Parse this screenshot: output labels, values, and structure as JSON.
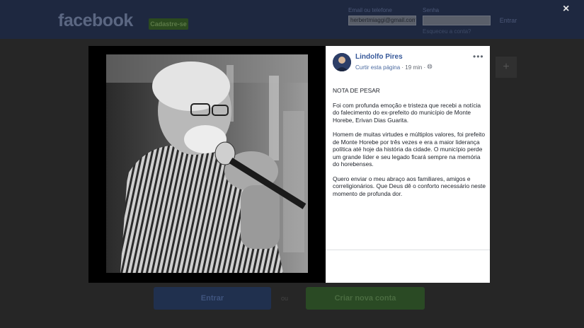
{
  "background": {
    "logo": "facebook",
    "signup_button": "Cadastre-se",
    "email_label": "Email ou telefone",
    "email_value": "herbertmiaggi@gmail.com",
    "password_label": "Senha",
    "login_button": "Entrar",
    "forgot_link": "Esqueceu a conta?",
    "bottom_login": "Entrar",
    "bottom_or": "ou",
    "bottom_create": "Criar nova conta"
  },
  "close_icon": "×",
  "post": {
    "author": "Lindolfo Pires",
    "like_page": "Curtir esta página",
    "separator": "·",
    "time": "19 min",
    "privacy_icon": "globe-icon",
    "more_menu": "•••",
    "title": "NOTA DE PESAR",
    "paragraphs": [
      "Foi com profunda emoção e tristeza que recebi a notícia do falecimento do ex-prefeito do município de Monte Horebe, Erivan Dias Guarita.",
      "Homem de muitas virtudes e múltiplos valores, foi prefeito de Monte Horebe por três vezes e era a maior liderança política até hoje da história da cidade. O município perde um grande líder e seu legado ficará sempre na memória do horebenses.",
      "Quero enviar o meu abraço aos familiares, amigos e correligionários. Que Deus dê o conforto necessário neste momento de profunda dor."
    ]
  },
  "colors": {
    "overlay": "#262626",
    "link_blue": "#365899",
    "photo_tone": "#3a3a3a"
  }
}
